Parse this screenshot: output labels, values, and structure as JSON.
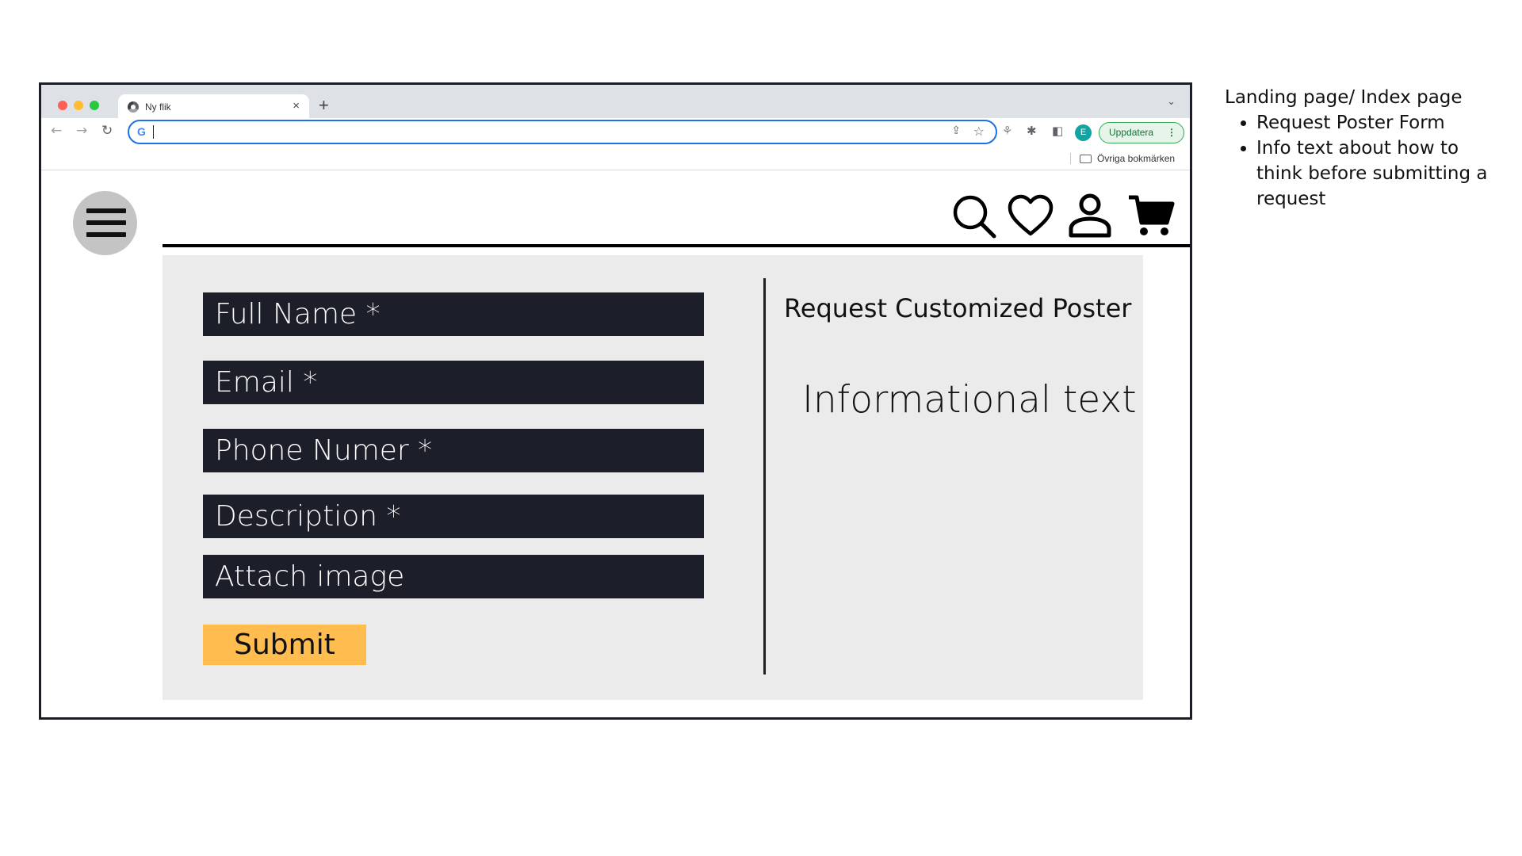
{
  "browser": {
    "tab_title": "Ny flik",
    "tab_close": "×",
    "new_tab": "+",
    "tab_menu": "⌄",
    "address_value": "",
    "google_badge": "G",
    "profile_initial": "E",
    "update_label": "Uppdatera",
    "update_menu": "⋮",
    "bookmarks_label": "Övriga bokmärken"
  },
  "site": {
    "menu_icon": "hamburger-menu-icon",
    "header_icons": [
      "search-icon",
      "heart-icon",
      "user-icon",
      "cart-icon"
    ],
    "form": {
      "fields": [
        "Full Name *",
        "Email *",
        "Phone Numer *",
        "Description *",
        "Attach image"
      ],
      "submit_label": "Submit"
    },
    "side_panel": {
      "title": "Request Customized Poster",
      "info": "Informational text"
    }
  },
  "notes": {
    "heading": "Landing page/ Index page",
    "items": [
      "Request Poster Form",
      "Info text about how to think before submitting a request"
    ]
  },
  "colors": {
    "field_bg": "#1c1f2a",
    "panel_bg": "#ebebeb",
    "submit_bg": "#ffbd4f",
    "menu_circle": "#c4c4c4",
    "frame_border": "#1c1c2a"
  }
}
